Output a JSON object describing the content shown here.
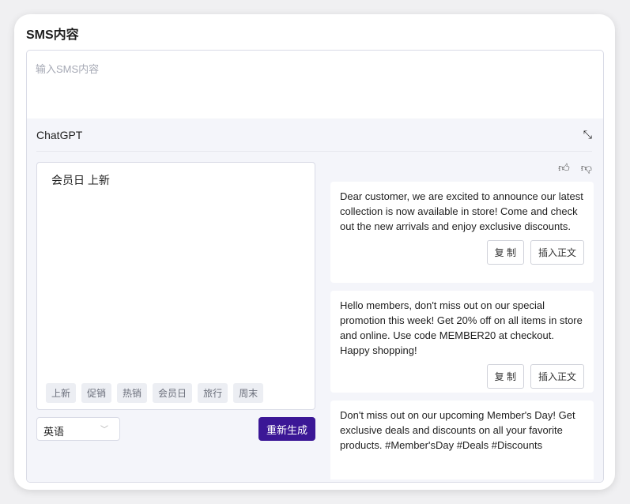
{
  "title": "SMS内容",
  "sms_input": {
    "placeholder": "输入SMS内容",
    "value": ""
  },
  "chatgpt": {
    "title": "ChatGPT",
    "prompt": "会员日 上新",
    "tags": [
      "上新",
      "促销",
      "热销",
      "会员日",
      "旅行",
      "周末"
    ],
    "language": "英语",
    "regenerate_label": "重新生成",
    "accent_color": "#3b1796",
    "responses": [
      {
        "text": "Dear customer, we are excited to announce our latest collection is now available in store! Come and check out the new arrivals and enjoy exclusive discounts.",
        "copy_label": "复 制",
        "insert_label": "插入正文"
      },
      {
        "text": "Hello members, don't miss out on our special promotion this week! Get 20% off on all items in store and online. Use code MEMBER20 at checkout. Happy shopping!",
        "copy_label": "复 制",
        "insert_label": "插入正文"
      },
      {
        "text": "Don't miss out on our upcoming Member's Day! Get exclusive deals and discounts on all your favorite products. #Member'sDay #Deals #Discounts"
      }
    ]
  }
}
